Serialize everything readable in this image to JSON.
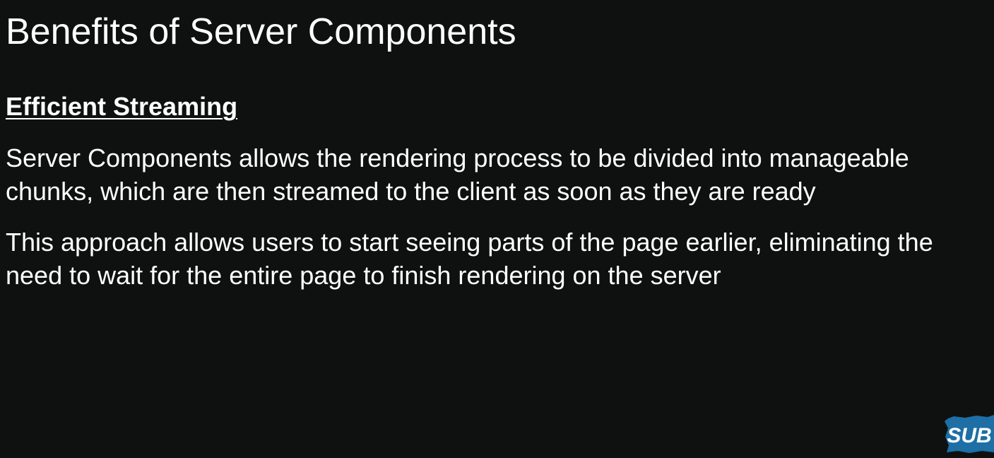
{
  "slide": {
    "title": "Benefits of Server Components",
    "section_heading": "Efficient Streaming",
    "paragraphs": [
      {
        "lines": [
          "Server Components allows the rendering process to be divided into manageable",
          "chunks, which are then streamed to the client as soon as they are ready"
        ]
      },
      {
        "lines": [
          "This approach allows users to start seeing parts of the page earlier, eliminating the",
          "need to wait for the entire page to finish rendering on the server"
        ]
      }
    ]
  },
  "badge": {
    "label": "SUB",
    "color": "#1d6fa5"
  },
  "colors": {
    "background": "#0f1111",
    "text": "#ffffff"
  }
}
